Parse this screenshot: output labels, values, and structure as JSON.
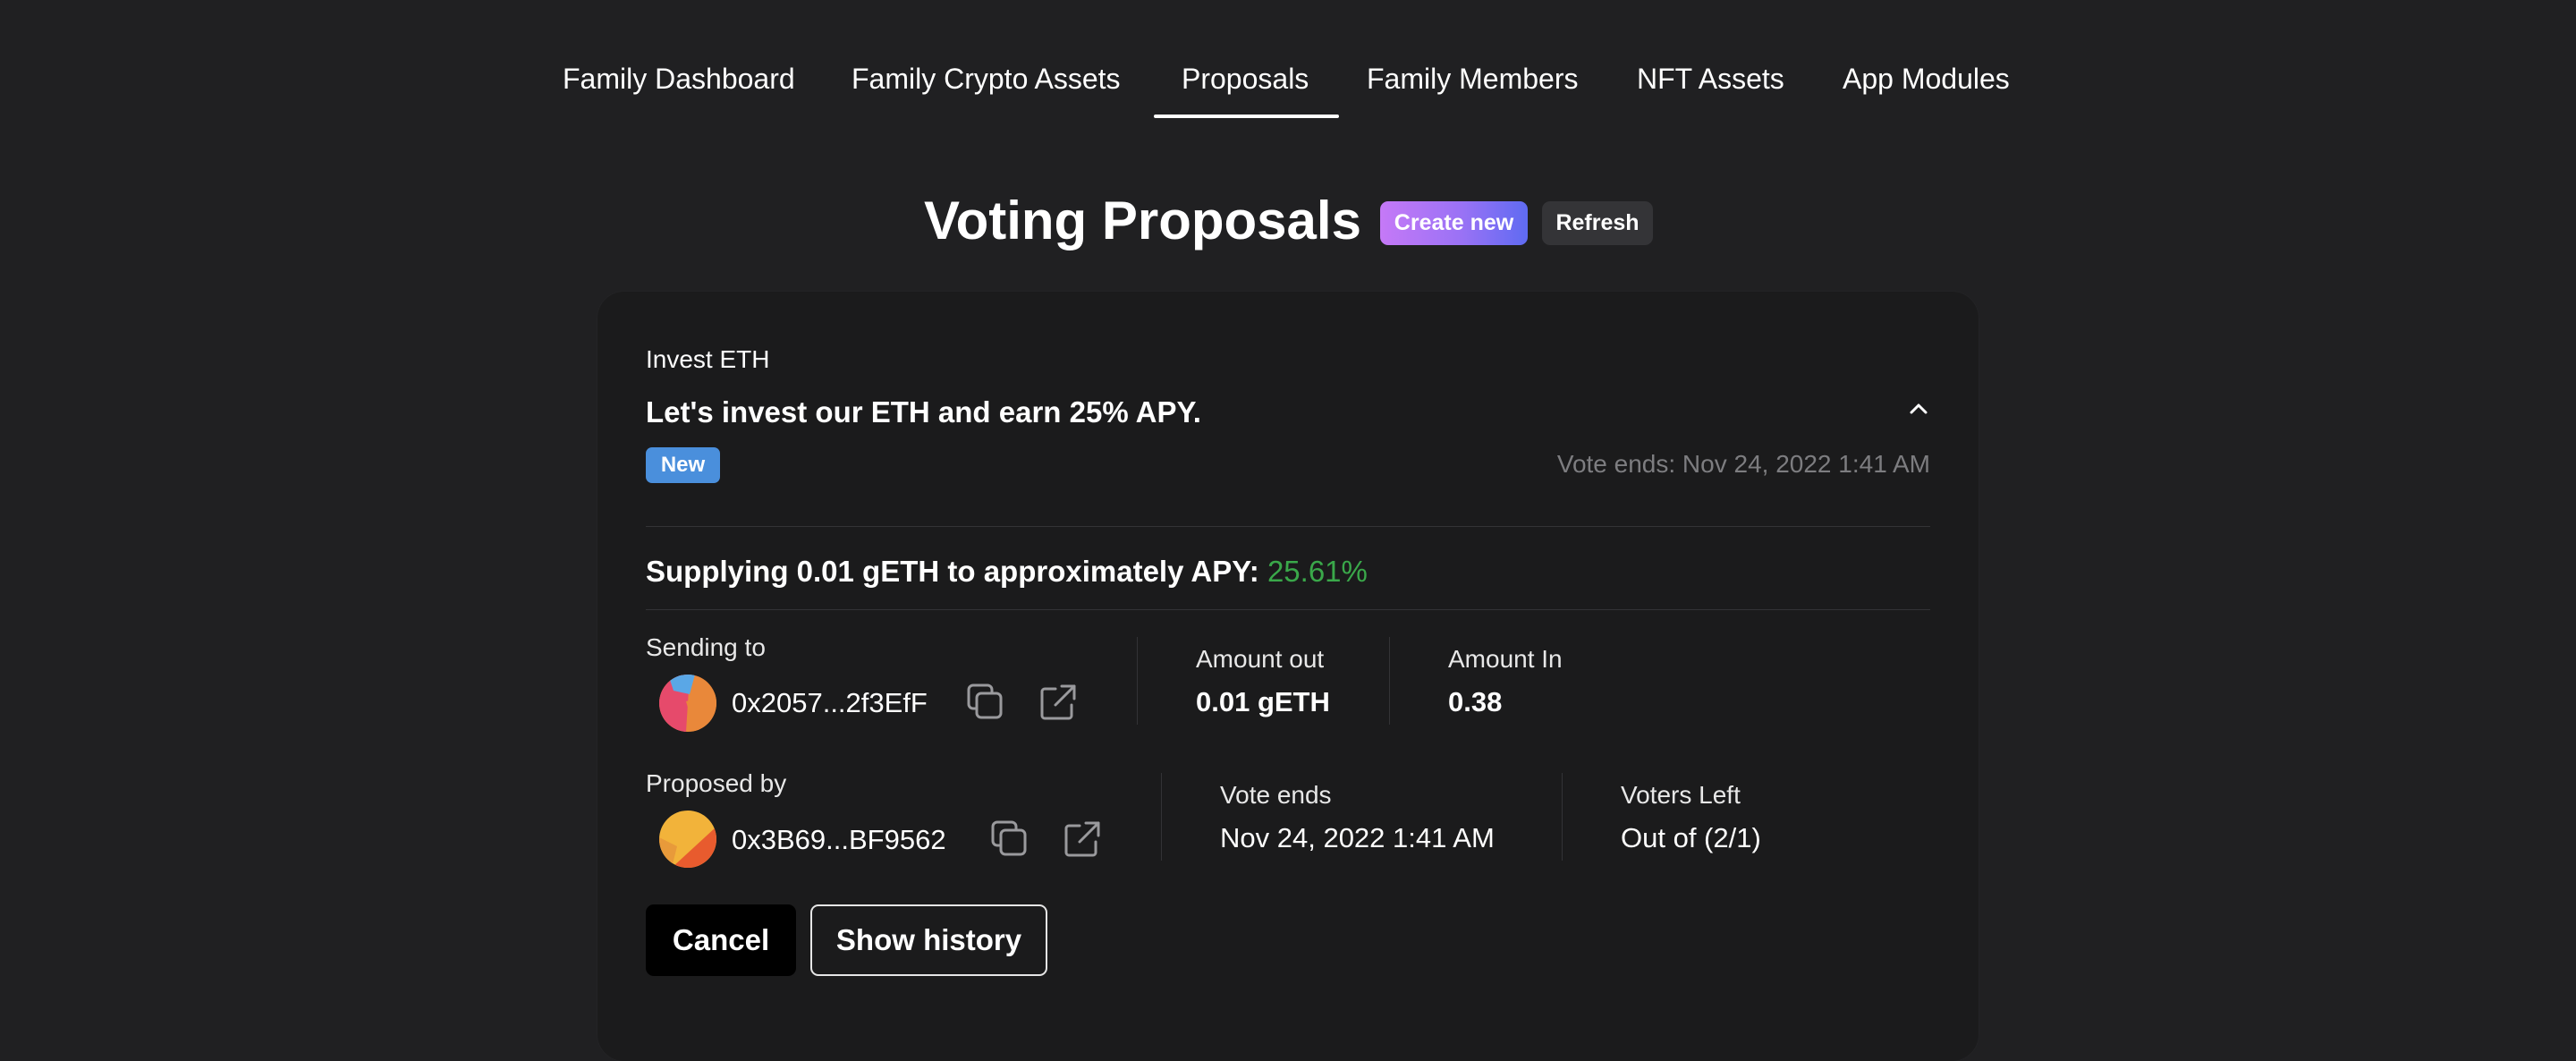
{
  "nav": {
    "tabs": [
      {
        "label": "Family Dashboard"
      },
      {
        "label": "Family Crypto Assets"
      },
      {
        "label": "Proposals",
        "active": true
      },
      {
        "label": "Family Members"
      },
      {
        "label": "NFT Assets"
      },
      {
        "label": "App Modules"
      }
    ]
  },
  "header": {
    "title": "Voting Proposals",
    "create_label": "Create new",
    "refresh_label": "Refresh"
  },
  "proposal": {
    "category": "Invest ETH",
    "title": "Let's invest our ETH and earn 25% APY.",
    "status_badge": "New",
    "vote_ends_text": "Vote ends: Nov 24, 2022 1:41 AM",
    "supply_text": "Supplying 0.01 gETH to approximately APY:",
    "apy": "25.61%",
    "sending_to": {
      "label": "Sending to",
      "address": "0x2057...2f3EfF"
    },
    "amount_out": {
      "label": "Amount out",
      "value": "0.01 gETH"
    },
    "amount_in": {
      "label": "Amount In",
      "value": "0.38"
    },
    "proposed_by": {
      "label": "Proposed by",
      "address": "0x3B69...BF9562"
    },
    "vote_ends": {
      "label": "Vote ends",
      "value": "Nov 24, 2022 1:41 AM"
    },
    "voters_left": {
      "label": "Voters Left",
      "value": "Out of (2/1)"
    },
    "cancel_label": "Cancel",
    "history_label": "Show history"
  },
  "icons": {
    "chevron": "chevron-up-icon",
    "copy": "copy-icon",
    "external": "external-link-icon"
  },
  "colors": {
    "background": "#202022",
    "card": "#1b1b1c",
    "badge": "#4a8fdc",
    "apy_green": "#3aa84a",
    "muted": "#7d7d80",
    "gradient_start": "#c579f7",
    "gradient_end": "#5f6bf2"
  }
}
